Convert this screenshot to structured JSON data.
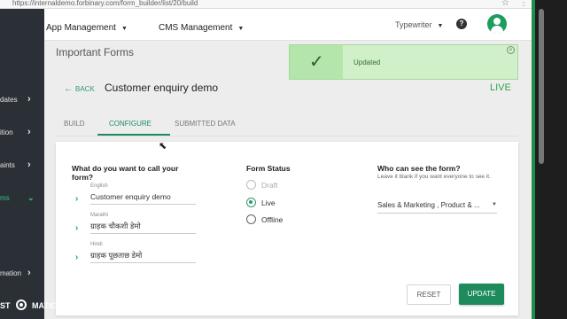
{
  "browser": {
    "url": "https://internaldemo.forbinary.com/form_builder/list/20/build"
  },
  "sidebar": {
    "items": [
      {
        "label": "dates",
        "active": false
      },
      {
        "label": "ition",
        "active": false
      },
      {
        "label": "aints",
        "active": false
      },
      {
        "label": "ms",
        "active": true
      },
      {
        "label": "mation",
        "active": false
      }
    ],
    "brand_left": "ST",
    "brand_right": "MATIC"
  },
  "topbar": {
    "nav": [
      "App Management",
      "CMS Management"
    ],
    "language": "Typewriter"
  },
  "page": {
    "title": "Important Forms",
    "back_label": "BACK",
    "form_name": "Customer enquiry demo",
    "status": "LIVE"
  },
  "tabs": [
    {
      "label": "BUILD",
      "active": false
    },
    {
      "label": "CONFIGURE",
      "active": true
    },
    {
      "label": "SUBMITTED DATA",
      "active": false
    }
  ],
  "form_config": {
    "name_question": "What do you want to call your form?",
    "names": [
      {
        "language": "English",
        "value": "Customer enquiry demo"
      },
      {
        "language": "Marathi",
        "value": "ग्राहक चौकशी डेमो"
      },
      {
        "language": "Hindi",
        "value": "ग्राहक पूछताछ डेमो"
      }
    ],
    "status_title": "Form Status",
    "status_options": [
      {
        "label": "Draft",
        "checked": false,
        "disabled": true
      },
      {
        "label": "Live",
        "checked": true,
        "disabled": false
      },
      {
        "label": "Offline",
        "checked": false,
        "disabled": false
      }
    ],
    "visibility_title": "Who can see the form?",
    "visibility_hint": "Leave it blank if you want everyone to see it.",
    "visibility_value": "Sales & Marketing , Product & ...",
    "reset_label": "RESET",
    "update_label": "UPDATE"
  },
  "toast": {
    "message": "Updated"
  },
  "colors": {
    "primary": "#1d8b5c",
    "live": "#2ea44f",
    "sidebar": "#2b2f36",
    "toast_bg": "#cff0c8"
  }
}
